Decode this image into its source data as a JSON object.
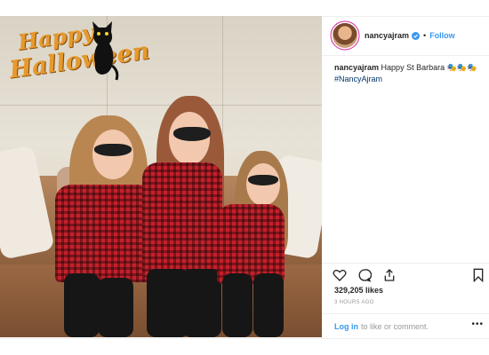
{
  "photo": {
    "overlay_line1": "Happy",
    "overlay_line2": "Halloween",
    "palette": {
      "shirt": "#c4202b",
      "sofa": "#8a5d3b",
      "wall": "#e8e3d7",
      "overlay_text": "#e69a2e"
    }
  },
  "header": {
    "username": "nancyajram",
    "verified_icon": "verified-badge-icon",
    "separator": "•",
    "follow_label": "Follow"
  },
  "caption": {
    "username": "nancyajram",
    "text": "Happy St Barbara 🎭🎭🎭",
    "hashtag": "#NancyAjram"
  },
  "actions": {
    "icons": [
      "heart-icon",
      "comment-icon",
      "share-icon",
      "bookmark-icon"
    ]
  },
  "likes": "329,205 likes",
  "timestamp": "3 HOURS AGO",
  "login": {
    "link_label": "Log in",
    "text": "to like or comment."
  },
  "more_label": "•••",
  "colors": {
    "accent": "#3897f0",
    "text": "#262626",
    "muted": "#999999",
    "border": "#efefef"
  }
}
